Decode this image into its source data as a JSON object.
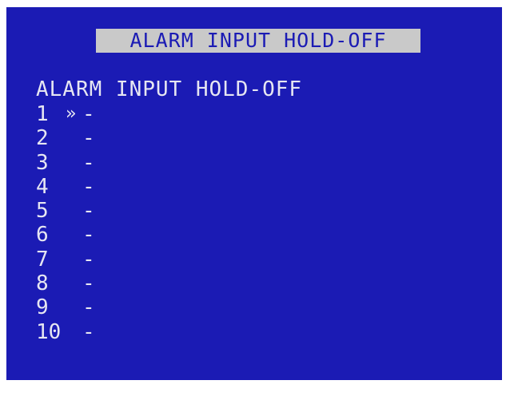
{
  "window": {
    "title": "ALARM INPUT HOLD-OFF"
  },
  "menu": {
    "heading": "ALARM INPUT HOLD-OFF",
    "cursor_glyph": "»",
    "selected_index": 0,
    "items": [
      {
        "number": "1",
        "value": "-"
      },
      {
        "number": "2",
        "value": "-"
      },
      {
        "number": "3",
        "value": "-"
      },
      {
        "number": "4",
        "value": "-"
      },
      {
        "number": "5",
        "value": "-"
      },
      {
        "number": "6",
        "value": "-"
      },
      {
        "number": "7",
        "value": "-"
      },
      {
        "number": "8",
        "value": "-"
      },
      {
        "number": "9",
        "value": "-"
      },
      {
        "number": "10",
        "value": "-"
      }
    ]
  },
  "colors": {
    "background": "#1b1bb4",
    "title_bar": "#c9c9c9",
    "text": "#e6e6f2"
  }
}
